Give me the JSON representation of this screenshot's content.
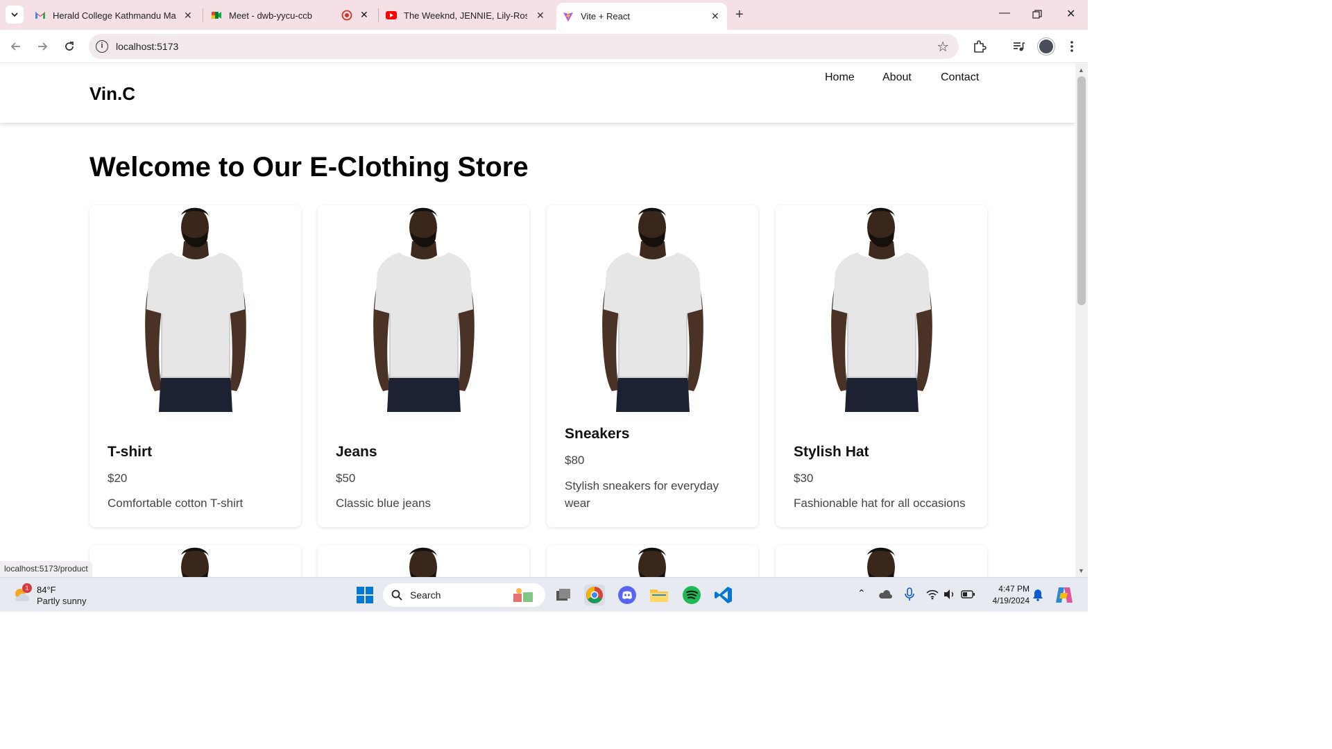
{
  "browser": {
    "tabs": [
      {
        "title": "Herald College Kathmandu Ma",
        "icon": "gmail-icon"
      },
      {
        "title": "Meet - dwb-yycu-ccb",
        "icon": "meet-icon"
      },
      {
        "title": "",
        "icon": "record-icon"
      },
      {
        "title": "The Weeknd, JENNIE, Lily-Rose",
        "icon": "youtube-icon"
      },
      {
        "title": "Vite + React",
        "icon": "vite-icon"
      }
    ],
    "url": "localhost:5173",
    "status_url": "localhost:5173/product"
  },
  "site": {
    "logo": "Vin.C",
    "nav": [
      "Home",
      "About",
      "Contact"
    ],
    "heading": "Welcome to Our E-Clothing Store",
    "products": [
      {
        "name": "T-shirt",
        "price": "$20",
        "description": "Comfortable cotton T-shirt"
      },
      {
        "name": "Jeans",
        "price": "$50",
        "description": "Classic blue jeans"
      },
      {
        "name": "Sneakers",
        "price": "$80",
        "description": "Stylish sneakers for everyday wear"
      },
      {
        "name": "Stylish Hat",
        "price": "$30",
        "description": "Fashionable hat for all occasions"
      }
    ]
  },
  "taskbar": {
    "weather_temp": "84°F",
    "weather_cond": "Partly sunny",
    "weather_badge": "1",
    "search_label": "Search",
    "time": "4:47 PM",
    "date": "4/19/2024"
  }
}
